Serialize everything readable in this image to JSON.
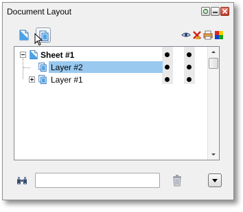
{
  "window": {
    "title": "Document Layout",
    "title_buttons": [
      "restore-icon",
      "minimize-icon",
      "close-icon"
    ]
  },
  "toolbar": {
    "tools": [
      "sheet-icon",
      "layer-icon"
    ],
    "header_icons": [
      "eye-icon",
      "delete-x-icon",
      "print-icon",
      "color-squares-icon"
    ]
  },
  "tree": {
    "rows": [
      {
        "label": "Sheet #1",
        "bold": true,
        "expanded": true,
        "icon": "sheet-icon",
        "selected": false
      },
      {
        "label": "Layer #2",
        "bold": false,
        "expanded": false,
        "icon": "layer-icon",
        "selected": true
      },
      {
        "label": "Layer #1",
        "bold": false,
        "expanded": false,
        "collapsed_has_children": true,
        "icon": "layer-icon",
        "selected": false
      }
    ]
  },
  "search": {
    "value": "",
    "placeholder": ""
  },
  "colors": {
    "selection": "#99c9ef",
    "window_bg": "#f0f0f0"
  }
}
